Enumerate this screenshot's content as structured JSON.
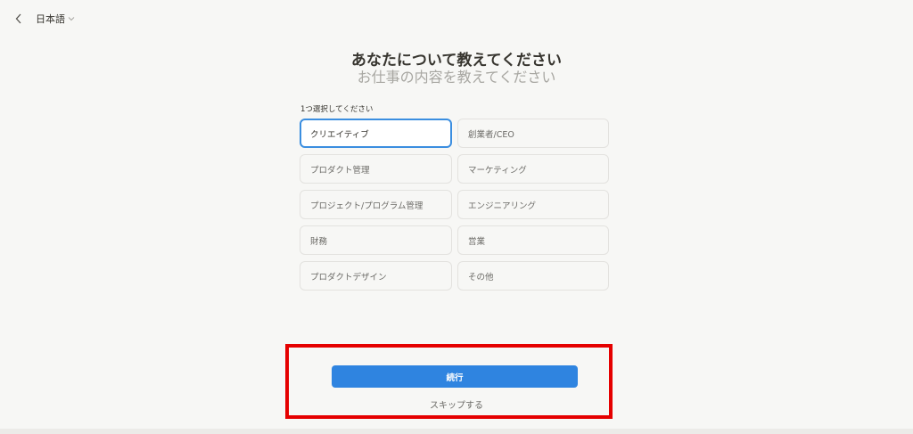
{
  "topbar": {
    "back_icon": "chevron-left-icon",
    "language_label": "日本語",
    "language_chevron_icon": "chevron-down-icon"
  },
  "header": {
    "title": "あなたについて教えてください",
    "subtitle": "お仕事の内容を教えてください"
  },
  "form": {
    "prompt": "1つ選択してください",
    "options": [
      {
        "label": "クリエイティブ",
        "selected": true
      },
      {
        "label": "創業者/CEO",
        "selected": false
      },
      {
        "label": "プロダクト管理",
        "selected": false
      },
      {
        "label": "マーケティング",
        "selected": false
      },
      {
        "label": "プロジェクト/プログラム管理",
        "selected": false
      },
      {
        "label": "エンジニアリング",
        "selected": false
      },
      {
        "label": "財務",
        "selected": false
      },
      {
        "label": "営業",
        "selected": false
      },
      {
        "label": "プロダクトデザイン",
        "selected": false
      },
      {
        "label": "その他",
        "selected": false
      }
    ]
  },
  "actions": {
    "continue_label": "続行",
    "skip_label": "スキップする"
  },
  "colors": {
    "accent": "#2f84e0",
    "selected_border": "#3b8ee0",
    "highlight": "#e50000",
    "background": "#f7f7f5"
  }
}
